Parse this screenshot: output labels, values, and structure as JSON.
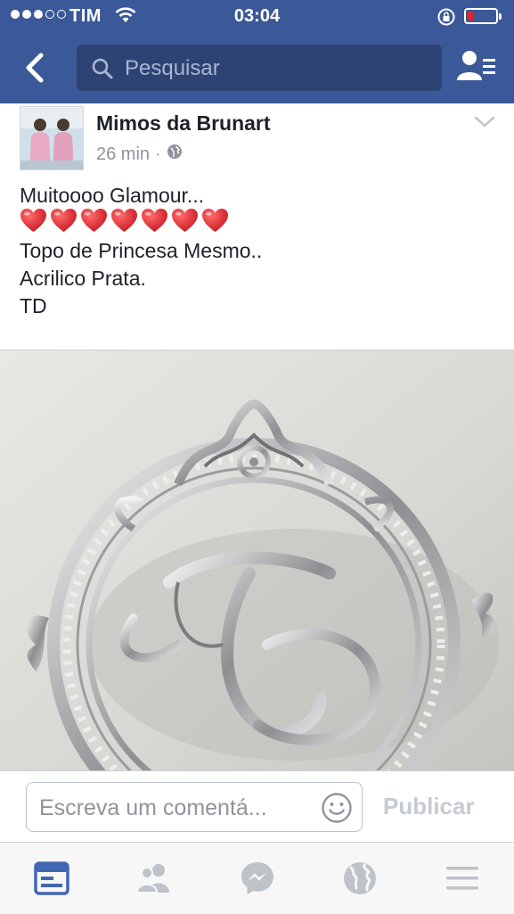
{
  "status_bar": {
    "carrier": "TIM",
    "time": "03:04",
    "signal_filled": 3,
    "signal_total": 5,
    "battery_level": 0.2,
    "battery_color": "#e2262a"
  },
  "nav": {
    "search_placeholder": "Pesquisar",
    "bar_color": "#3b5998"
  },
  "post": {
    "author": "Mimos da Brunart",
    "time_ago": "26 min",
    "separator": "·",
    "lines": [
      "Muitoooo Glamour...",
      "❤️❤️❤️❤️❤️❤️❤️",
      "Topo de Princesa Mesmo..",
      "Acrilico Prata.",
      "TD"
    ],
    "heart_count": 7
  },
  "composer": {
    "placeholder": "Escreva um comentá...",
    "publish_label": "Publicar"
  },
  "tabs": [
    {
      "icon": "news-feed-icon",
      "active": true
    },
    {
      "icon": "friend-requests-icon",
      "active": false
    },
    {
      "icon": "messenger-icon",
      "active": false
    },
    {
      "icon": "globe-notifications-icon",
      "active": false
    },
    {
      "icon": "more-menu-icon",
      "active": false
    }
  ],
  "colors": {
    "active_tab": "#4267b2",
    "inactive_tab": "#bec3c9"
  }
}
